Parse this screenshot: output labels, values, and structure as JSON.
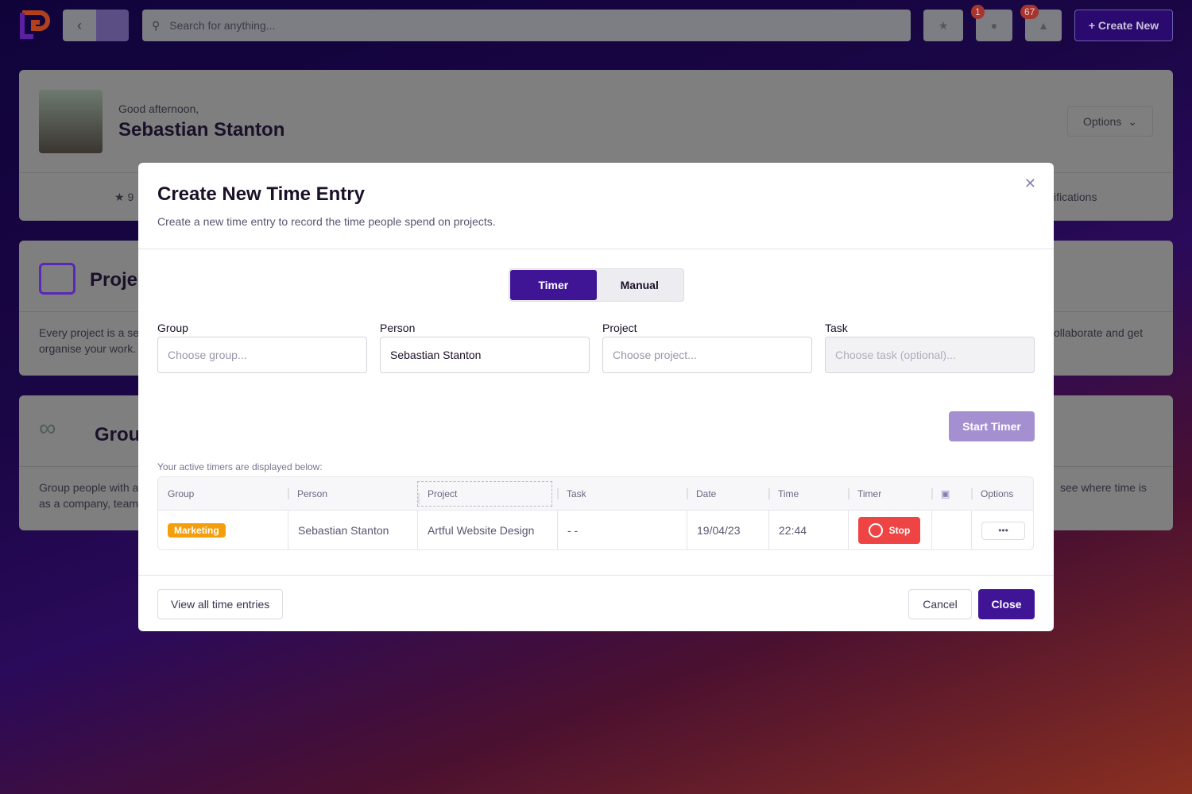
{
  "topbar": {
    "search_placeholder": "Search for anything...",
    "badges": {
      "fire": "1",
      "bell": "67"
    },
    "create_label": "+ Create New"
  },
  "welcome": {
    "greeting": "Good afternoon,",
    "name": "Sebastian Stanton",
    "options_label": "Options",
    "stat_partial": "9",
    "tab_partial": "ifications"
  },
  "cards": [
    {
      "title": "Projec",
      "desc1": "Every project is a se",
      "desc2": "organise your work.",
      "right_desc": "ollaborate and get"
    },
    {
      "title": "Grou",
      "desc1": "Group people with a",
      "desc2": "as a company, team",
      "right_desc": "see where time is"
    }
  ],
  "modal": {
    "title": "Create New Time Entry",
    "subtitle": "Create a new time entry to record the time people spend on projects.",
    "tabs": [
      {
        "label": "Timer",
        "active": true
      },
      {
        "label": "Manual",
        "active": false
      }
    ],
    "fields": [
      {
        "label": "Group",
        "value": "",
        "placeholder": "Choose group..."
      },
      {
        "label": "Person",
        "value": "Sebastian Stanton",
        "placeholder": ""
      },
      {
        "label": "Project",
        "value": "",
        "placeholder": "Choose project..."
      },
      {
        "label": "Task",
        "value": "",
        "placeholder": "Choose task (optional)...",
        "disabled": true
      }
    ],
    "start_label": "Start Timer",
    "active_note": "Your active timers are displayed below:",
    "table": {
      "headers": [
        "Group",
        "Person",
        "Project",
        "Task",
        "Date",
        "Time",
        "Timer",
        "",
        "Options"
      ],
      "rows": [
        {
          "group": "Marketing",
          "person": "Sebastian Stanton",
          "project": "Artful Website Design",
          "task": "- -",
          "date": "19/04/23",
          "time": "22:44",
          "timer": "Stop"
        }
      ]
    },
    "view_all_label": "View all time entries",
    "cancel_label": "Cancel",
    "close_label": "Close"
  },
  "colors": {
    "accent": "#3f1596",
    "stop": "#ef4444",
    "tag": "#f59e0b"
  }
}
